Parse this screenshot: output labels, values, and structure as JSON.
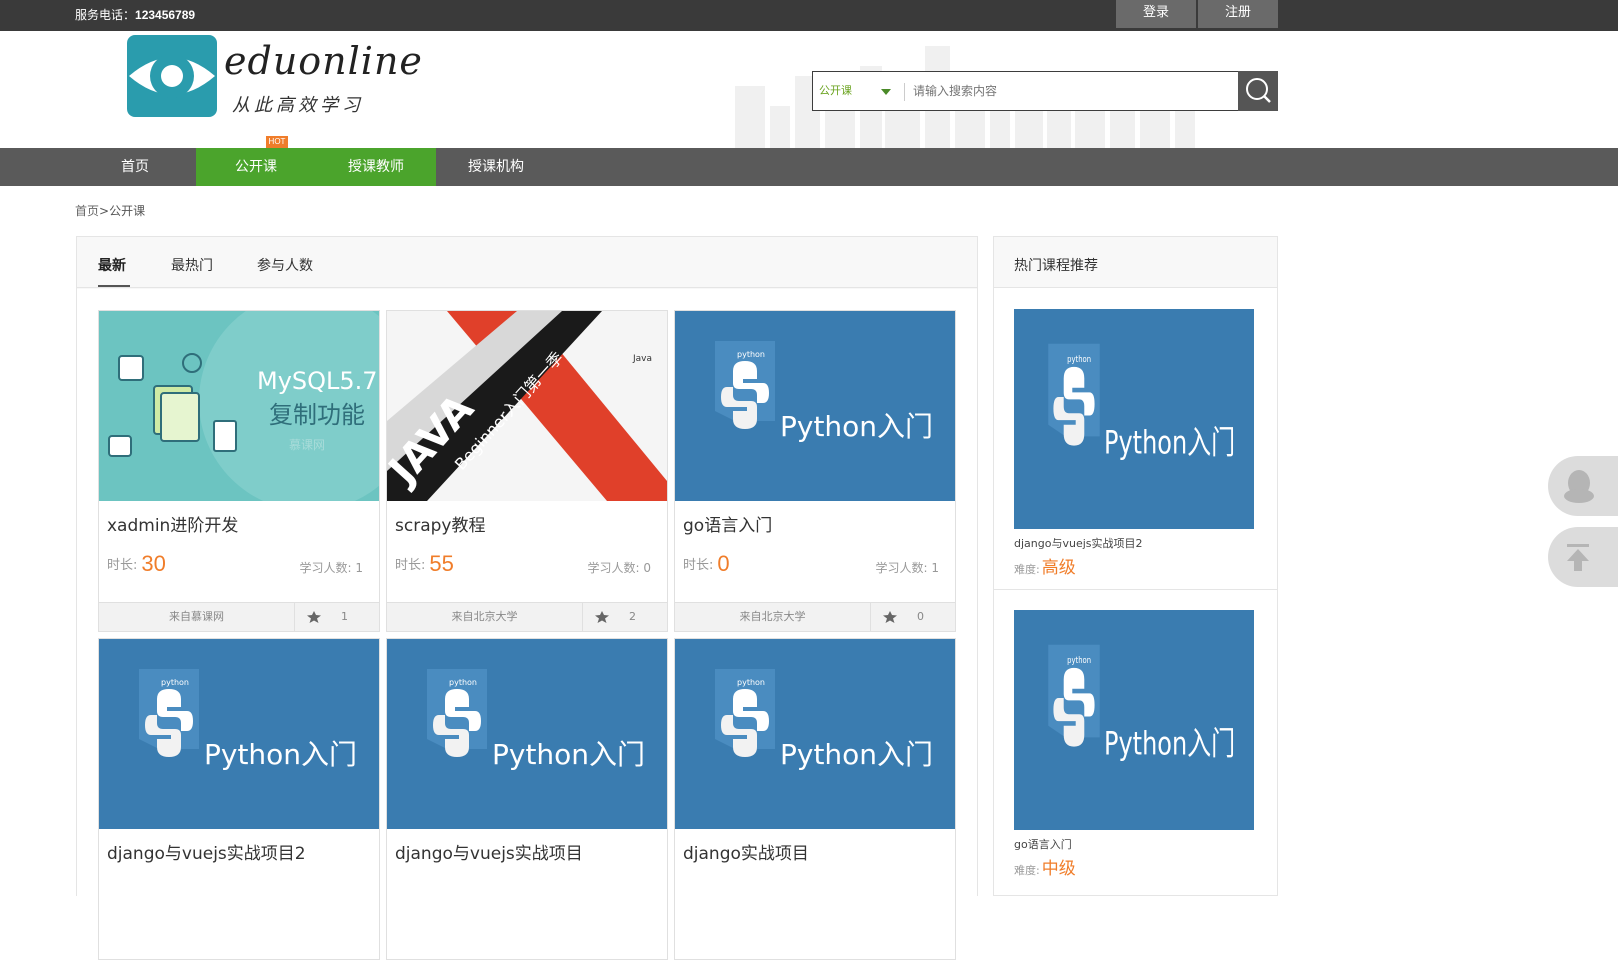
{
  "topbar": {
    "phone_label": "服务电话：",
    "phone": "123456789",
    "login": "登录",
    "register": "注册"
  },
  "logo": {
    "text": "eduonline",
    "slogan": "从此高效学习"
  },
  "search": {
    "category": "公开课",
    "placeholder": "请输入搜索内容"
  },
  "nav": {
    "items": [
      {
        "label": "首页"
      },
      {
        "label": "公开课"
      },
      {
        "label": "授课教师"
      },
      {
        "label": "授课机构"
      }
    ],
    "hot_badge": "HOT"
  },
  "breadcrumb": {
    "home": "首页",
    "sep": ">",
    "current": "公开课"
  },
  "tabs": [
    {
      "label": "最新"
    },
    {
      "label": "最热门"
    },
    {
      "label": "参与人数"
    }
  ],
  "labels": {
    "duration": "时长:",
    "learners": "学习人数:",
    "difficulty": "难度:"
  },
  "courses": [
    {
      "title": "xadmin进阶开发",
      "duration": "30",
      "learners": "1",
      "org": "来自慕课网",
      "fav": "1",
      "thumb": "mysql",
      "thumb_text": {
        "mysql": "MySQL5.7",
        "feature": "复制功能",
        "site": "慕课网"
      }
    },
    {
      "title": "scrapy教程",
      "duration": "55",
      "learners": "0",
      "org": "来自北京大学",
      "fav": "2",
      "thumb": "java",
      "thumb_text": {
        "java": "JAVA",
        "beginner": "Beginner入门第一季",
        "logo": "Java"
      }
    },
    {
      "title": "go语言入门",
      "duration": "0",
      "learners": "1",
      "org": "来自北京大学",
      "fav": "0",
      "thumb": "python"
    },
    {
      "title": "django与vuejs实战项目2",
      "thumb": "python"
    },
    {
      "title": "django与vuejs实战项目",
      "thumb": "python"
    },
    {
      "title": "django实战项目",
      "thumb": "python"
    }
  ],
  "python_thumb": {
    "badge": "python",
    "text": "Python入门"
  },
  "side": {
    "title": "热门课程推荐",
    "items": [
      {
        "name": "django与vuejs实战项目2",
        "level": "高级"
      },
      {
        "name": "go语言入门",
        "level": "中级"
      }
    ]
  },
  "colors": {
    "accent_green": "#4ba42c",
    "orange": "#f07d2a",
    "python_blue": "#3a7cb0",
    "topbar": "#3a3a3a",
    "nav": "#5a5a5a"
  },
  "icons": {
    "search": "search-icon",
    "favorite": "star-icon",
    "qq": "qq-icon",
    "back_to_top": "back-to-top-icon"
  }
}
